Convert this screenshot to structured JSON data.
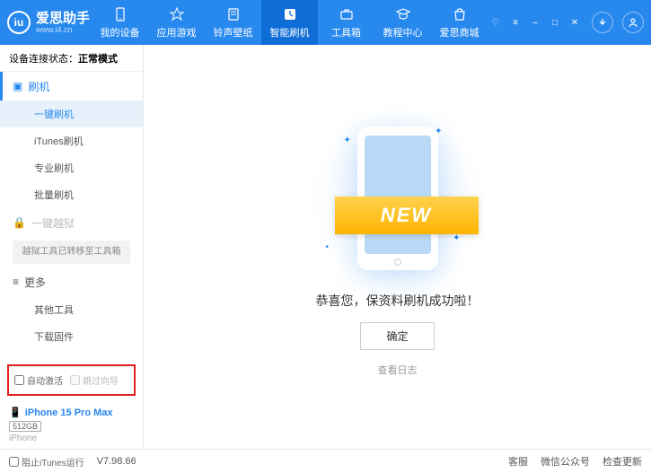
{
  "app": {
    "name": "爱思助手",
    "url": "www.i4.cn"
  },
  "winbtns": {
    "gift": "♡",
    "menu": "≡",
    "min": "–",
    "max": "□",
    "close": "✕"
  },
  "nav": [
    {
      "label": "我的设备"
    },
    {
      "label": "应用游戏"
    },
    {
      "label": "铃声壁纸"
    },
    {
      "label": "智能刷机"
    },
    {
      "label": "工具箱"
    },
    {
      "label": "教程中心"
    },
    {
      "label": "爱思商城"
    }
  ],
  "sidebar": {
    "status_label": "设备连接状态：",
    "status_value": "正常模式",
    "flash_head": "刷机",
    "flash_items": [
      "一键刷机",
      "iTunes刷机",
      "专业刷机",
      "批量刷机"
    ],
    "jailbreak_head": "一键越狱",
    "jailbreak_note": "越狱工具已转移至工具箱",
    "more_head": "更多",
    "more_items": [
      "其他工具",
      "下载固件",
      "高级功能"
    ],
    "cb_auto": "自动激活",
    "cb_skip": "跳过向导",
    "device": {
      "name": "iPhone 15 Pro Max",
      "storage": "512GB",
      "os": "iPhone"
    }
  },
  "main": {
    "ribbon": "NEW",
    "message": "恭喜您，保资料刷机成功啦！",
    "ok": "确定",
    "loglink": "查看日志"
  },
  "footer": {
    "block_itunes": "阻止iTunes运行",
    "version": "V7.98.66",
    "service": "客服",
    "wechat": "微信公众号",
    "update": "检查更新"
  }
}
